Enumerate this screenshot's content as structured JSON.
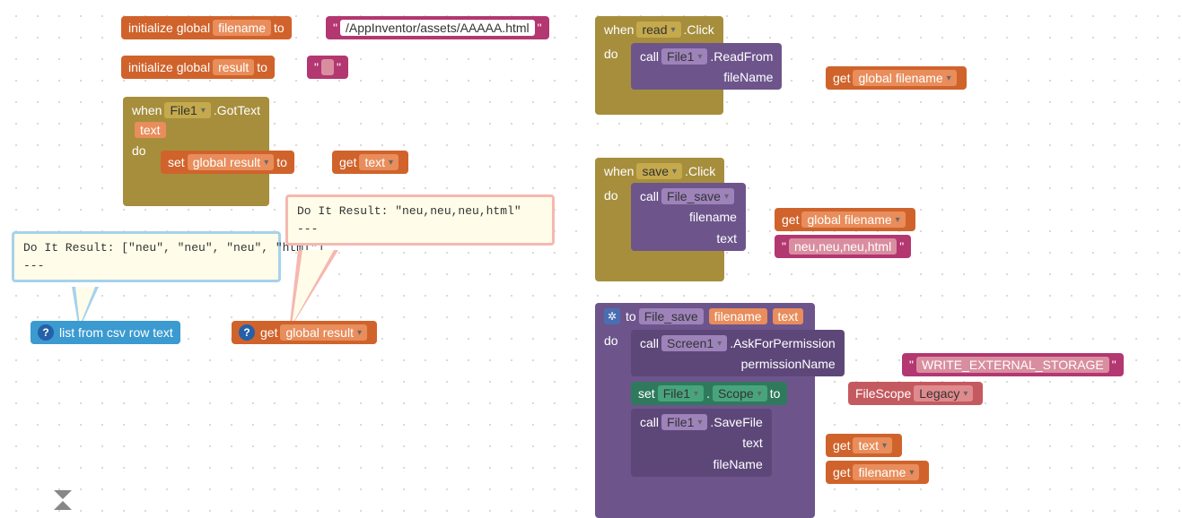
{
  "kw": {
    "init": "initialize global",
    "to": "to",
    "when": "when",
    "do": "do",
    "call": "call",
    "set": "set",
    "get": "get",
    "filescope": "FileScope"
  },
  "b1": {
    "var": "filename",
    "val": "/AppInventor/assets/AAAAA.html"
  },
  "b2": {
    "var": "result",
    "val": ""
  },
  "b3": {
    "comp": "File1",
    "evt": ".GotText",
    "param": "text",
    "target": "global result",
    "arg": "text"
  },
  "b4": {
    "label": "list from csv row  text",
    "get": "global result"
  },
  "b5": {
    "comp": "read",
    "evt": ".Click",
    "call": "File1",
    "method": ".ReadFrom",
    "argname": "fileName",
    "argval": "global filename"
  },
  "b6": {
    "comp": "save",
    "evt": ".Click",
    "call": "File_save",
    "a1": "filename",
    "a1v": "global filename",
    "a2": "text",
    "a2v": "neu,neu,neu,html"
  },
  "b7": {
    "proc": "File_save",
    "p1": "filename",
    "p2": "text",
    "l1": {
      "comp": "Screen1",
      "method": ".AskForPermission",
      "arg": "permissionName",
      "val": "WRITE_EXTERNAL_STORAGE"
    },
    "l2": {
      "comp": "File1",
      "prop": "Scope",
      "val": "Legacy"
    },
    "l3": {
      "comp": "File1",
      "method": ".SaveFile",
      "a1": "text",
      "a1v": "text",
      "a2": "fileName",
      "a2v": "filename"
    }
  },
  "tip1": "Do It Result: [\"neu\", \"neu\", \"neu\", \"html\"]\n---",
  "tip2": "Do It Result: \"neu,neu,neu,html\"\n---"
}
